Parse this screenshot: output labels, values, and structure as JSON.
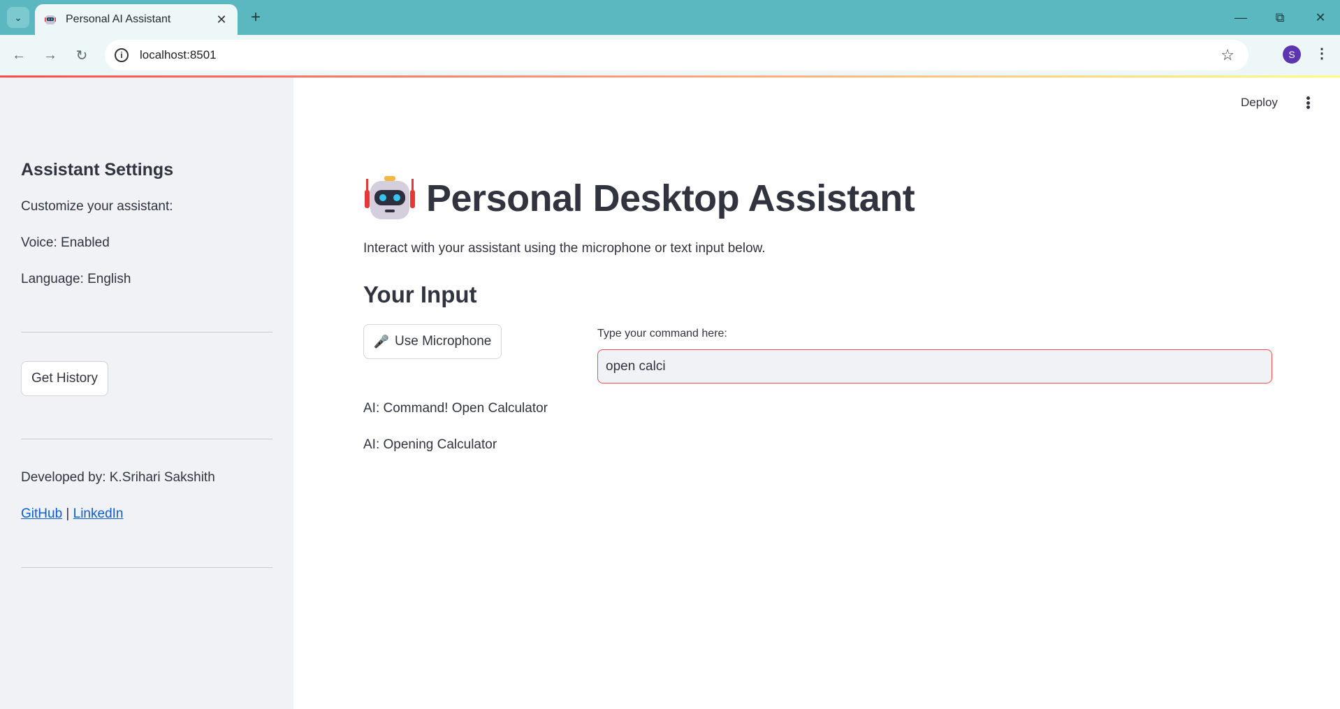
{
  "browser": {
    "tab_title": "Personal AI Assistant",
    "url": "localhost:8501",
    "profile_initial": "S"
  },
  "sidebar": {
    "heading": "Assistant Settings",
    "customize_text": "Customize your assistant:",
    "voice_text": "Voice: Enabled",
    "language_text": "Language: English",
    "history_button": "Get History",
    "developer_text": "Developed by: K.Srihari Sakshith",
    "github_link": "GitHub",
    "separator": "|",
    "linkedin_link": "LinkedIn"
  },
  "main": {
    "deploy_label": "Deploy",
    "title": "Personal Desktop Assistant",
    "subtitle": "Interact with your assistant using the microphone or text input below.",
    "input_section_heading": "Your Input",
    "mic_button_label": "Use Microphone",
    "command_label": "Type your command here:",
    "command_value": "open calci",
    "responses": [
      "AI: Command! Open Calculator",
      "AI: Opening Calculator"
    ]
  },
  "colors": {
    "accent": "#ff4b4b",
    "sidebar_bg": "#f0f2f6",
    "link": "#0b5cd5",
    "browser_frame": "#5bb8c0"
  }
}
